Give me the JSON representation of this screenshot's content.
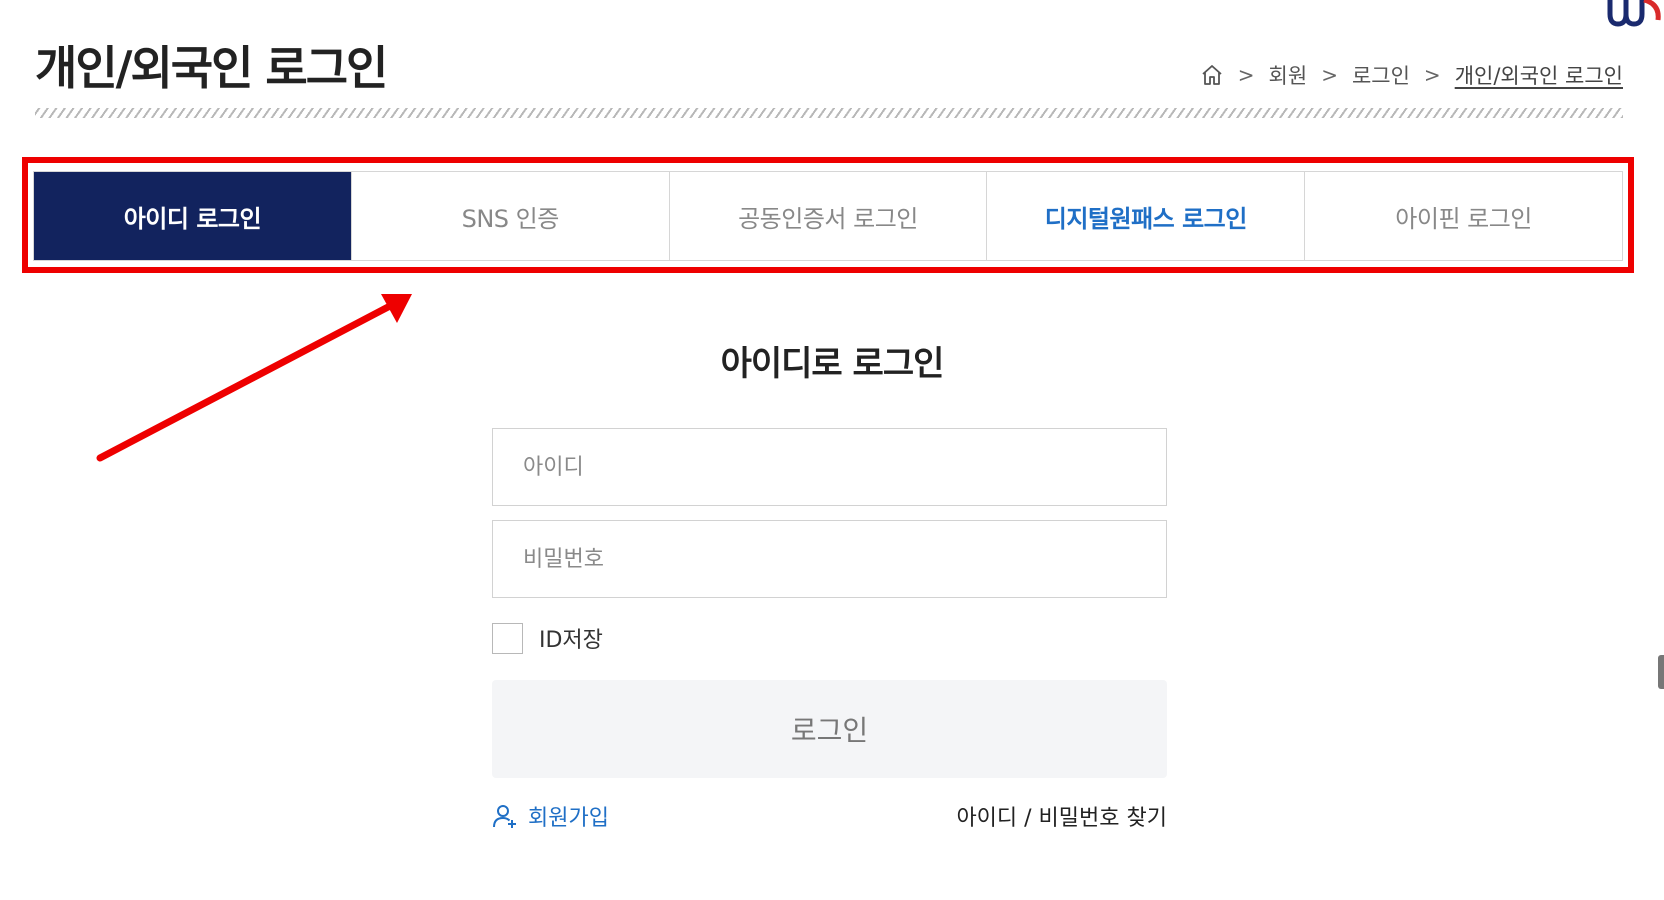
{
  "header": {
    "title": "개인/외국인 로그인"
  },
  "breadcrumb": {
    "home_icon": "home-icon",
    "separator": ">",
    "items": [
      "회원",
      "로그인",
      "개인/외국인 로그인"
    ]
  },
  "tabs": [
    {
      "label": "아이디 로그인",
      "active": true
    },
    {
      "label": "SNS 인증",
      "active": false
    },
    {
      "label": "공동인증서 로그인",
      "active": false
    },
    {
      "label": "디지털원패스 로그인",
      "active": false
    },
    {
      "label": "아이핀 로그인",
      "active": false
    }
  ],
  "login": {
    "title": "아이디로 로그인",
    "id_placeholder": "아이디",
    "password_placeholder": "비밀번호",
    "save_id_label": "ID저장",
    "login_button": "로그인",
    "signup_label": "회원가입",
    "find_label": "아이디 / 비밀번호 찾기"
  },
  "colors": {
    "active_tab_bg": "#12235e",
    "highlight_red": "#ee0000",
    "link_blue": "#1f6fc6"
  }
}
